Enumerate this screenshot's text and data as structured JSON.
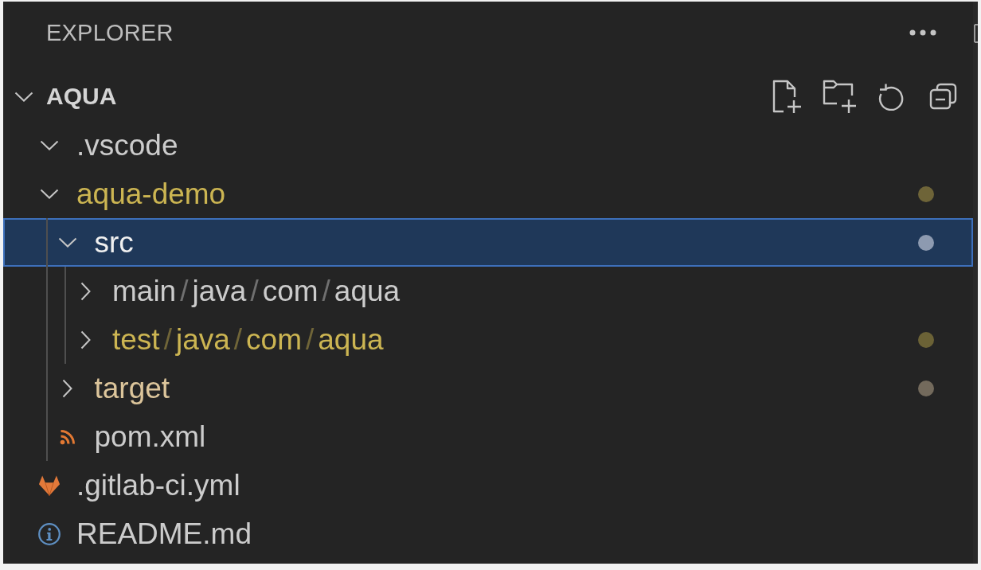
{
  "sidebar": {
    "title": "EXPLORER"
  },
  "section": {
    "title": "AQUA",
    "expanded": true
  },
  "tree": [
    {
      "label": ".vscode",
      "kind": "folder",
      "expanded": true,
      "selected": false,
      "warning": false,
      "modified": false
    },
    {
      "label": "aqua-demo",
      "kind": "folder",
      "expanded": true,
      "selected": false,
      "warning": true,
      "modified": false,
      "color": "#6e6438",
      "children": [
        {
          "label": "src",
          "kind": "folder",
          "expanded": true,
          "selected": true,
          "warning": false,
          "modified": false,
          "color": "#8d9ab0",
          "children": [
            {
              "path": [
                "main",
                "java",
                "com",
                "aqua"
              ],
              "separator": "/",
              "kind": "folder",
              "expanded": false,
              "selected": false,
              "warning": false,
              "modified": false
            },
            {
              "path": [
                "test",
                "java",
                "com",
                "aqua"
              ],
              "separator": "/",
              "kind": "folder",
              "expanded": false,
              "selected": false,
              "warning": true,
              "modified": false,
              "color": "#6b6236"
            }
          ]
        },
        {
          "label": "target",
          "kind": "folder",
          "expanded": false,
          "selected": false,
          "warning": false,
          "modified": true,
          "color": "#736a5c"
        },
        {
          "label": "pom.xml",
          "kind": "xml",
          "selected": false,
          "warning": false,
          "modified": false
        }
      ]
    },
    {
      "label": ".gitlab-ci.yml",
      "kind": "yaml",
      "selected": false,
      "warning": false,
      "modified": false
    },
    {
      "label": "README.md",
      "kind": "markdown",
      "selected": false,
      "warning": false,
      "modified": false
    }
  ]
}
